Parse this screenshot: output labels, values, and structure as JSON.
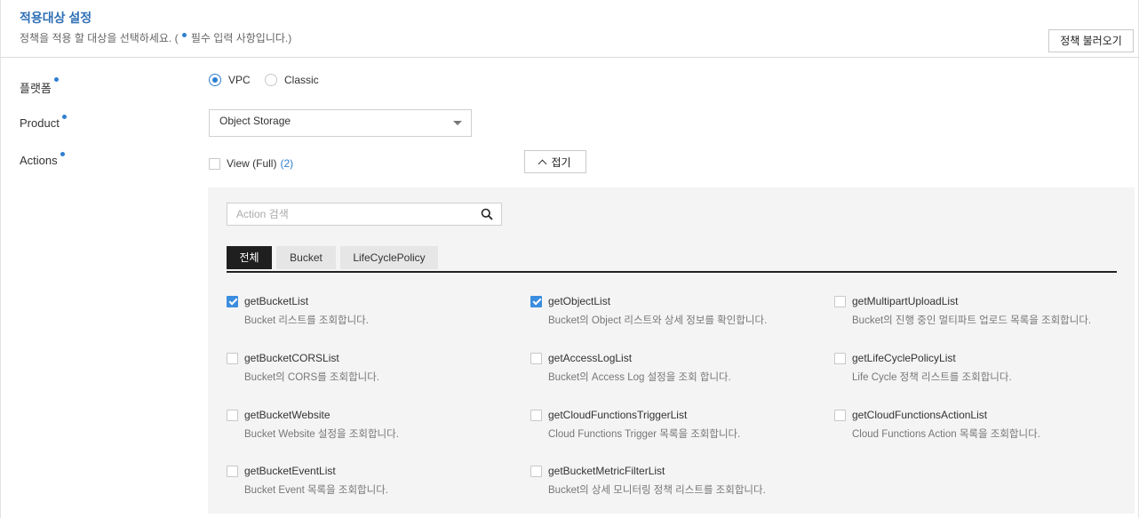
{
  "header": {
    "title": "적용대상 설정",
    "desc_before": "정책을 적용 할 대상을 선택하세요. (",
    "desc_after": " 필수 입력 사항입니다.)",
    "load_button": "정책 불러오기"
  },
  "platform": {
    "label": "플랫폼",
    "options": [
      {
        "label": "VPC",
        "checked": true
      },
      {
        "label": "Classic",
        "checked": false
      }
    ]
  },
  "product": {
    "label": "Product",
    "selected": "Object Storage"
  },
  "actions": {
    "label": "Actions",
    "view_full_label": "View (Full)",
    "view_full_count": "(2)",
    "collapse_button": "접기",
    "search_placeholder": "Action 검색",
    "tabs": [
      {
        "label": "전체",
        "active": true
      },
      {
        "label": "Bucket",
        "active": false
      },
      {
        "label": "LifeCyclePolicy",
        "active": false
      }
    ],
    "items": [
      {
        "name": "getBucketList",
        "desc": "Bucket 리스트를 조회합니다.",
        "checked": true
      },
      {
        "name": "getObjectList",
        "desc": "Bucket의 Object 리스트와 상세 정보를 확인합니다.",
        "checked": true
      },
      {
        "name": "getMultipartUploadList",
        "desc": "Bucket의 진행 중인 멀티파트 업로드 목록을 조회합니다.",
        "checked": false
      },
      {
        "name": "getBucketCORSList",
        "desc": "Bucket의 CORS를 조회합니다.",
        "checked": false
      },
      {
        "name": "getAccessLogList",
        "desc": "Bucket의 Access Log 설정을 조회 합니다.",
        "checked": false
      },
      {
        "name": "getLifeCyclePolicyList",
        "desc": "Life Cycle 정책 리스트를 조회합니다.",
        "checked": false
      },
      {
        "name": "getBucketWebsite",
        "desc": "Bucket Website 설정을 조회합니다.",
        "checked": false
      },
      {
        "name": "getCloudFunctionsTriggerList",
        "desc": "Cloud Functions Trigger 목록을 조회합니다.",
        "checked": false
      },
      {
        "name": "getCloudFunctionsActionList",
        "desc": "Cloud Functions Action 목록을 조회합니다.",
        "checked": false
      },
      {
        "name": "getBucketEventList",
        "desc": "Bucket Event 목록을 조회합니다.",
        "checked": false
      },
      {
        "name": "getBucketMetricFilterList",
        "desc": "Bucket의 상세 모니터링 정책 리스트를 조회합니다.",
        "checked": false
      }
    ]
  },
  "colors": {
    "accent": "#2f7fd1",
    "title": "#2f6fb5",
    "checkbox_checked": "#3b8de0",
    "panel_bg": "#f4f4f4",
    "tab_active_bg": "#1f1f1f"
  }
}
